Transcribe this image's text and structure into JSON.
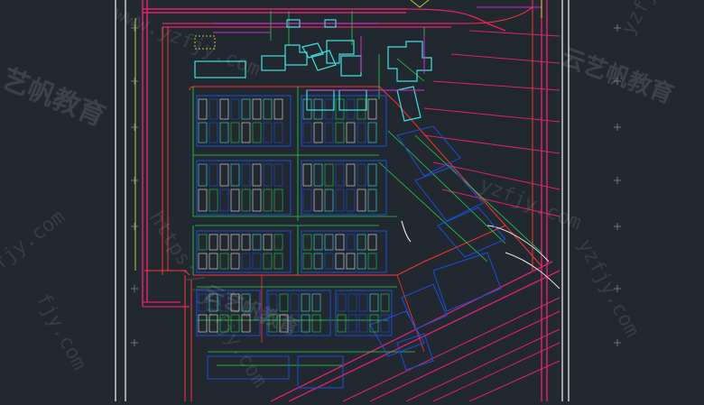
{
  "canvas": {
    "background": "#212830",
    "paper_border_color": "#e6e6e6",
    "road_color": "#e0226e",
    "aux_road_color": "#ff3333",
    "building_color": "#1b4fd8",
    "dimension_color": "#22d14a",
    "annotation_color": "#c8c832",
    "cyan_color": "#3fe0e0",
    "magenta_color": "#d62ad6"
  },
  "watermarks": {
    "brand_cn_1": "云艺帆教育",
    "brand_cn_2": "云艺帆教育",
    "brand_cn_3": "艺帆教育",
    "url_1": "www.yzfjy.com",
    "url_2": "https://yzfjy.com",
    "url_3": "yzfjy.com",
    "url_4": "fjy.com",
    "url_5": "yzfjy",
    "url_6": "yzfjy.com",
    "url_7": "fjy.com"
  }
}
